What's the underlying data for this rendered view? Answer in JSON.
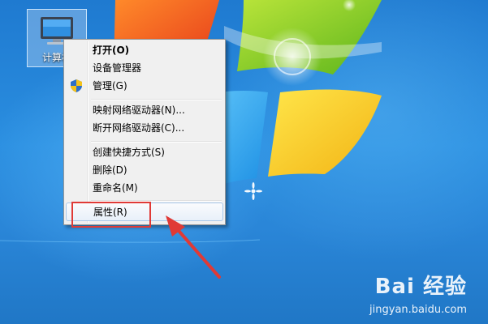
{
  "desktop": {
    "icon_label": "计算机"
  },
  "context_menu": {
    "items": [
      {
        "label": "打开(O)"
      },
      {
        "label": "设备管理器"
      },
      {
        "label": "管理(G)"
      },
      {
        "label": "映射网络驱动器(N)..."
      },
      {
        "label": "断开网络驱动器(C)..."
      },
      {
        "label": "创建快捷方式(S)"
      },
      {
        "label": "删除(D)"
      },
      {
        "label": "重命名(M)"
      },
      {
        "label": "属性(R)"
      }
    ],
    "highlighted_item": "属性(R)"
  },
  "annotation": {
    "highlight_color": "#e03a36"
  },
  "watermark": {
    "brand": "Bai 经验",
    "url": "jingyan.baidu.com"
  }
}
